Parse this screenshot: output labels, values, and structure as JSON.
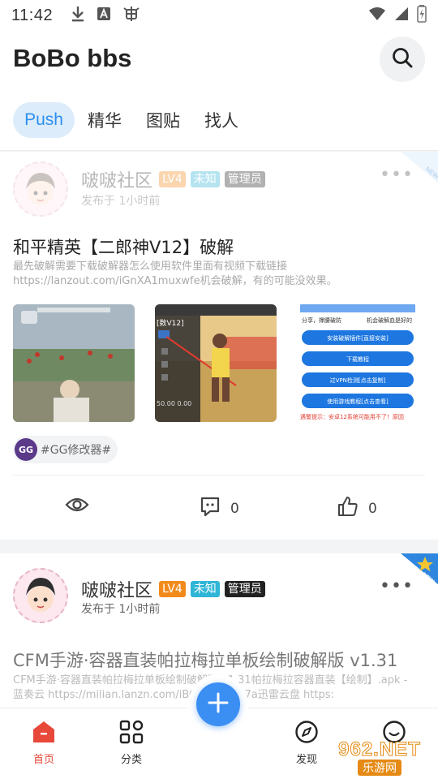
{
  "status_bar": {
    "time": "11:42"
  },
  "header": {
    "title": "BoBo bbs"
  },
  "tabs": [
    {
      "label": "Push",
      "active": true
    },
    {
      "label": "精华",
      "active": false
    },
    {
      "label": "图贴",
      "active": false
    },
    {
      "label": "找人",
      "active": false
    }
  ],
  "posts": [
    {
      "author": "啵啵社区",
      "level": "LV4",
      "tag_unknown": "未知",
      "role": "管理员",
      "time": "发布于 1小时前",
      "title": "和平精英【二郎神V12】破解",
      "body": "最先破解需要下载破解器怎么使用软件里面有视频下载链接 https://lanzout.com/iGnXA1muxwfe机会破解，有的可能没效果。",
      "images": [
        {
          "caption": ""
        },
        {
          "caption": "[数V12]",
          "values": [
            "50.00 0.00"
          ]
        },
        {
          "header_text": "分享，撑腰破防",
          "header_text_2": "机会破解血是好的",
          "buttons": [
            "安装破解插件[直接安装]",
            "下载教程",
            "过VPN检测[点击复制]",
            "使用游戏教程[点击查看]"
          ],
          "warning": "遇警提示：安卓12系统可能用不了！原因"
        }
      ],
      "topic": "#GG修改器#",
      "views": "",
      "comments": "0",
      "likes": "0"
    },
    {
      "author": "啵啵社区",
      "level": "LV4",
      "tag_unknown": "未知",
      "role": "管理员",
      "time": "发布于 1小时前",
      "title": "CFM手游·容器直装帕拉梅拉单板绘制破解版 v1.31",
      "body": "CFM手游·容器直装帕拉梅拉单板绘制破解版 v1.31帕拉梅拉容器直装【绘制】.apk - 蓝奏云 https://milian.lanzn.com/iBOOK1mt2r7a迅雷云盘 https:"
    }
  ],
  "ribbon_label": "NEW",
  "bottom_nav": {
    "items": [
      {
        "label": "首页",
        "icon": "home-icon",
        "active": true
      },
      {
        "label": "分类",
        "icon": "grid-icon",
        "active": false
      },
      {
        "label": "发现",
        "icon": "compass-icon",
        "active": false
      },
      {
        "label": "",
        "icon": "profile-icon",
        "active": false
      }
    ]
  },
  "watermark": {
    "top": "962.NET",
    "bottom": "乐游网"
  },
  "colors": {
    "accent": "#2d8ff0",
    "active_nav": "#e8483a",
    "fab": "#3b8ef2"
  }
}
